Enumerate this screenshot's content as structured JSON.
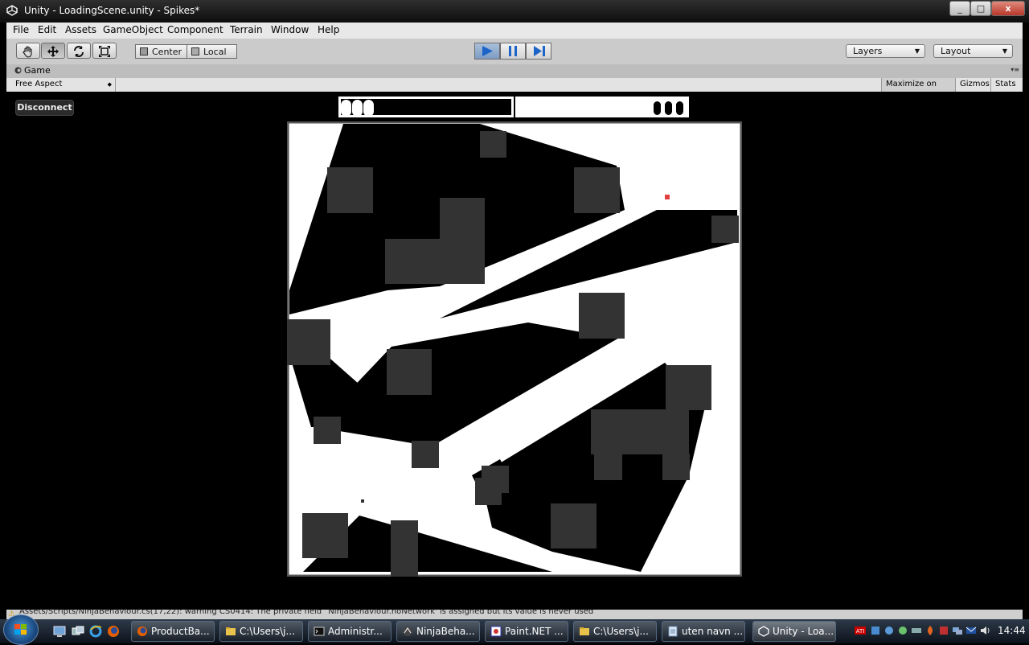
{
  "window": {
    "title": "Unity - LoadingScene.unity - Spikes*",
    "minimize": "_",
    "maximize": "□",
    "close": "x"
  },
  "menu": [
    "File",
    "Edit",
    "Assets",
    "GameObject",
    "Component",
    "Terrain",
    "Window",
    "Help"
  ],
  "toolbar": {
    "center_label": "Center",
    "local_label": "Local",
    "layers_label": "Layers",
    "layout_label": "Layout"
  },
  "game_view": {
    "tab_label": "Game",
    "aspect_label": "Free Aspect",
    "maximize_label": "Maximize on Play",
    "gizmos_label": "Gizmos",
    "stats_label": "Stats",
    "disconnect_label": "Disconnect"
  },
  "status": {
    "message": "Assets/Scripts/NinjaBehaviour.cs(17,22): warning CS0414: The private field `NinjaBehaviour.noNetwork' is assigned but its value is never used"
  },
  "taskbar": {
    "tasks": [
      "ProductBa...",
      "C:\\Users\\j...",
      "Administr...",
      "NinjaBeha...",
      "Paint.NET ...",
      "C:\\Users\\j...",
      "uten navn ...",
      "Unity - Loa..."
    ],
    "clock": "14:44"
  },
  "colors": {
    "accent": "#3b7fd6",
    "player_marker": "#e04040",
    "block": "#333333"
  }
}
